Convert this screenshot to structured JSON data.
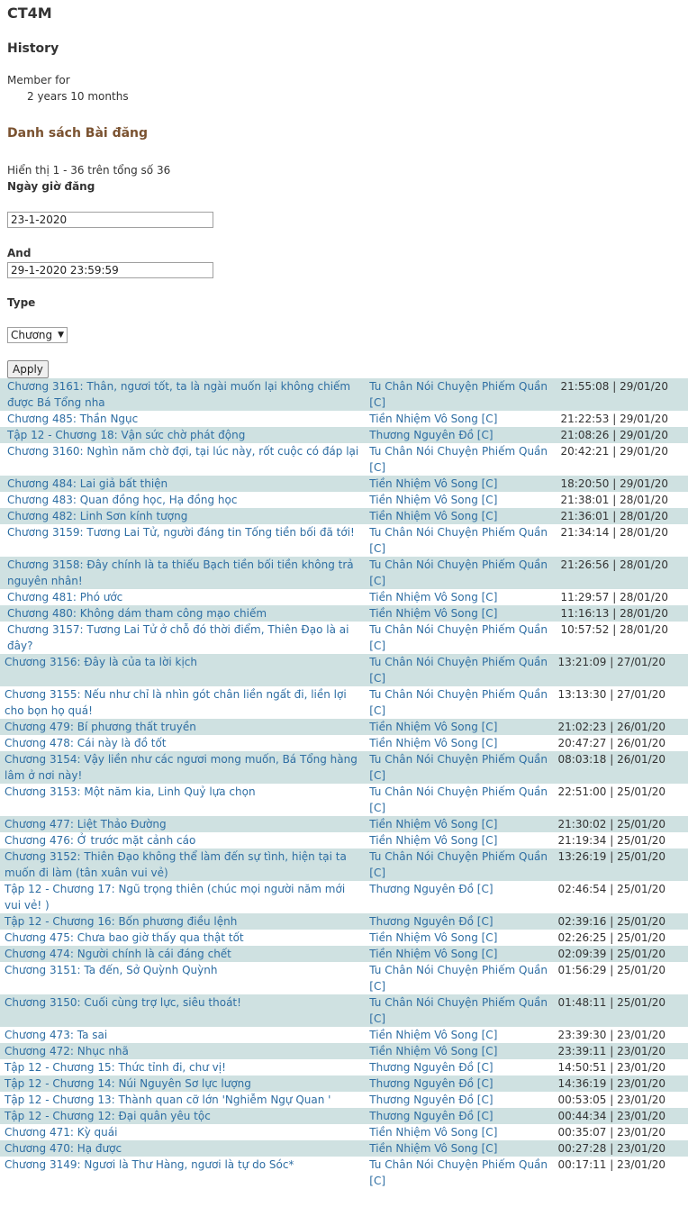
{
  "site": {
    "title": "CT4M"
  },
  "page": {
    "title": "History",
    "member_label": "Member for",
    "member_value": "2 years 10 months",
    "list_title": "Danh sách Bài đăng",
    "count_text": "Hiển thị 1 - 36 trên tổng số 36"
  },
  "filters": {
    "date_label": "Ngày giờ đăng",
    "date_from": "23-1-2020",
    "and_label": "And",
    "date_to": "29-1-2020 23:59:59",
    "type_label": "Type",
    "type_value": "Chương",
    "apply_label": "Apply"
  },
  "posts": [
    {
      "title": "Chương 3161: Thân, ngươi tốt, ta là ngài muốn lại không chiếm được Bá Tổng nha",
      "category": "Tu Chân Nói Chuyện Phiếm Quần [C]",
      "datetime": "21:55:08 | 29/01/20"
    },
    {
      "title": "Chương 485: Thần Ngục",
      "category": "Tiền Nhiệm Vô Song [C]",
      "datetime": "21:22:53 | 29/01/20"
    },
    {
      "title": "Tập 12 - Chương 18: Vận sức chờ phát động",
      "category": "Thương Nguyên Đồ [C]",
      "datetime": "21:08:26 | 29/01/20"
    },
    {
      "title": "Chương 3160: Nghìn năm chờ đợi, tại lúc này, rốt cuộc có đáp lại",
      "category": "Tu Chân Nói Chuyện Phiếm Quần [C]",
      "datetime": "20:42:21 | 29/01/20"
    },
    {
      "title": "Chương 484: Lai giả bất thiện",
      "category": "Tiền Nhiệm Vô Song [C]",
      "datetime": "18:20:50 | 29/01/20"
    },
    {
      "title": "Chương 483: Quan đồng học, Hạ đồng học",
      "category": "Tiền Nhiệm Vô Song [C]",
      "datetime": "21:38:01 | 28/01/20"
    },
    {
      "title": "Chương 482: Linh Sơn kính tượng",
      "category": "Tiền Nhiệm Vô Song [C]",
      "datetime": "21:36:01 | 28/01/20"
    },
    {
      "title": "Chương 3159: Tương Lai Tử, người đáng tin Tống tiền bối đã tới!",
      "category": "Tu Chân Nói Chuyện Phiếm Quần [C]",
      "datetime": "21:34:14 | 28/01/20"
    },
    {
      "title": "Chương 3158: Đây chính là ta thiếu Bạch tiền bối tiền không trả nguyên nhân!",
      "category": "Tu Chân Nói Chuyện Phiếm Quần [C]",
      "datetime": "21:26:56 | 28/01/20"
    },
    {
      "title": "Chương 481: Phó ước",
      "category": "Tiền Nhiệm Vô Song [C]",
      "datetime": "11:29:57 | 28/01/20"
    },
    {
      "title": "Chương 480: Không dám tham công mạo chiếm",
      "category": "Tiền Nhiệm Vô Song [C]",
      "datetime": "11:16:13 | 28/01/20"
    },
    {
      "title": "Chương 3157: Tương Lai Tử ở chỗ đó thời điểm, Thiên Đạo là ai đây?",
      "category": "Tu Chân Nói Chuyện Phiếm Quần [C]",
      "datetime": "10:57:52 | 28/01/20"
    },
    {
      "title": "Chương 3156: Đây là của ta lời kịch",
      "category": "Tu Chân Nói Chuyện Phiếm Quần [C]",
      "datetime": "13:21:09 | 27/01/20"
    },
    {
      "title": "Chương 3155: Nếu như chỉ là nhìn gót chân liền ngất đi, liền lợi cho bọn họ quá!",
      "category": "Tu Chân Nói Chuyện Phiếm Quần [C]",
      "datetime": "13:13:30 | 27/01/20"
    },
    {
      "title": "Chương 479: Bí phương thất truyền",
      "category": "Tiền Nhiệm Vô Song [C]",
      "datetime": "21:02:23 | 26/01/20"
    },
    {
      "title": "Chương 478: Cái này là đồ tốt",
      "category": "Tiền Nhiệm Vô Song [C]",
      "datetime": "20:47:27 | 26/01/20"
    },
    {
      "title": "Chương 3154: Vậy liền như các ngươi mong muốn, Bá Tổng hàng lâm ở nơi này!",
      "category": "Tu Chân Nói Chuyện Phiếm Quần [C]",
      "datetime": "08:03:18 | 26/01/20"
    },
    {
      "title": "Chương 3153: Một năm kia, Linh Quỷ lựa chọn",
      "category": "Tu Chân Nói Chuyện Phiếm Quần [C]",
      "datetime": "22:51:00 | 25/01/20"
    },
    {
      "title": "Chương 477: Liệt Thảo Đường",
      "category": "Tiền Nhiệm Vô Song [C]",
      "datetime": "21:30:02 | 25/01/20"
    },
    {
      "title": "Chương 476: Ở trước mặt cảnh cáo",
      "category": "Tiền Nhiệm Vô Song [C]",
      "datetime": "21:19:34 | 25/01/20"
    },
    {
      "title": "Chương 3152: Thiên Đạo không thể làm đến sự tình, hiện tại ta muốn đi làm (tân xuân vui vẻ)",
      "category": "Tu Chân Nói Chuyện Phiếm Quần [C]",
      "datetime": "13:26:19 | 25/01/20"
    },
    {
      "title": "Tập 12 - Chương 17: Ngũ trọng thiên (chúc mọi người năm mới vui vẻ! )",
      "category": "Thương Nguyên Đồ [C]",
      "datetime": "02:46:54 | 25/01/20"
    },
    {
      "title": "Tập 12 - Chương 16: Bốn phương điều lệnh",
      "category": "Thương Nguyên Đồ [C]",
      "datetime": "02:39:16 | 25/01/20"
    },
    {
      "title": "Chương 475: Chưa bao giờ thấy qua thật tốt",
      "category": "Tiền Nhiệm Vô Song [C]",
      "datetime": "02:26:25 | 25/01/20"
    },
    {
      "title": "Chương 474: Người chính là cái đáng chết",
      "category": "Tiền Nhiệm Vô Song [C]",
      "datetime": "02:09:39 | 25/01/20"
    },
    {
      "title": "Chương 3151: Ta đến, Sở Quỳnh Quỳnh",
      "category": "Tu Chân Nói Chuyện Phiếm Quần [C]",
      "datetime": "01:56:29 | 25/01/20"
    },
    {
      "title": "Chương 3150: Cuối cùng trợ lực, siêu thoát!",
      "category": "Tu Chân Nói Chuyện Phiếm Quần [C]",
      "datetime": "01:48:11 | 25/01/20"
    },
    {
      "title": "Chương 473: Ta sai",
      "category": "Tiền Nhiệm Vô Song [C]",
      "datetime": "23:39:30 | 23/01/20"
    },
    {
      "title": "Chương 472: Nhục nhã",
      "category": "Tiền Nhiệm Vô Song [C]",
      "datetime": "23:39:11 | 23/01/20"
    },
    {
      "title": "Tập 12 - Chương 15: Thức tỉnh đi, chư vị!",
      "category": "Thương Nguyên Đồ [C]",
      "datetime": "14:50:51 | 23/01/20"
    },
    {
      "title": "Tập 12 - Chương 14: Núi Nguyên Sơ lực lượng",
      "category": "Thương Nguyên Đồ [C]",
      "datetime": "14:36:19 | 23/01/20"
    },
    {
      "title": "Tập 12 - Chương 13: Thành quan cỡ lớn 'Nghiễm Ngự Quan '",
      "category": "Thương Nguyên Đồ [C]",
      "datetime": "00:53:05 | 23/01/20"
    },
    {
      "title": "Tập 12 - Chương 12: Đại quân yêu tộc",
      "category": "Thương Nguyên Đồ [C]",
      "datetime": "00:44:34 | 23/01/20"
    },
    {
      "title": "Chương 471: Kỳ quái",
      "category": "Tiền Nhiệm Vô Song [C]",
      "datetime": "00:35:07 | 23/01/20"
    },
    {
      "title": "Chương 470: Hạ được",
      "category": "Tiền Nhiệm Vô Song [C]",
      "datetime": "00:27:28 | 23/01/20"
    },
    {
      "title": "Chương 3149: Ngươi là Thư Hàng, ngươi là tự do Sóc*",
      "category": "Tu Chân Nói Chuyện Phiếm Quần [C]",
      "datetime": "00:17:11 | 23/01/20"
    }
  ]
}
